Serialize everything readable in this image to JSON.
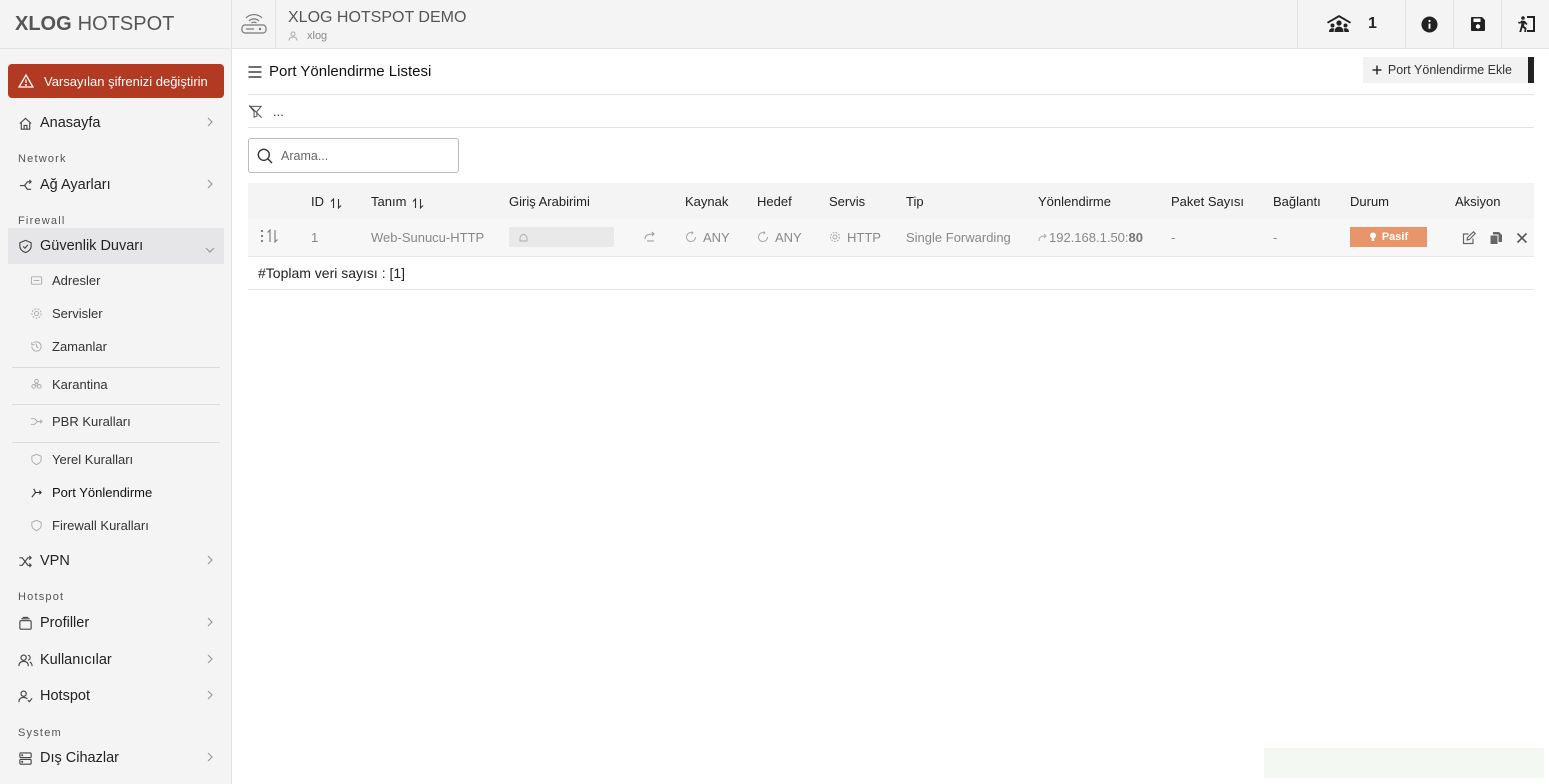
{
  "brand": {
    "bold": "XLOG",
    "light": "HOTSPOT"
  },
  "alert": {
    "text": "Varsayılan şifrenizi değiştirin"
  },
  "sidebar": {
    "home": "Anasayfa",
    "section_network": "Network",
    "network_settings": "Ağ Ayarları",
    "section_firewall": "Firewall",
    "firewall": "Güvenlik Duvarı",
    "sub": {
      "addresses": "Adresler",
      "services": "Servisler",
      "times": "Zamanlar",
      "quarantine": "Karantina",
      "pbr": "PBR Kuralları",
      "local_rules": "Yerel Kuralları",
      "port_forwarding": "Port Yönlendirme",
      "firewall_rules": "Firewall Kuralları"
    },
    "vpn": "VPN",
    "section_hotspot": "Hotspot",
    "profiles": "Profiller",
    "users": "Kullanıcılar",
    "hotspot": "Hotspot",
    "section_system": "System",
    "external_devices": "Dış Cihazlar"
  },
  "topbar": {
    "title": "XLOG HOTSPOT DEMO",
    "subtitle": "xlog",
    "online_count": "1"
  },
  "page": {
    "title": "Port Yönlendirme Listesi",
    "add_button": "Port Yönlendirme Ekle",
    "filter_text": "...",
    "search_placeholder": "Arama..."
  },
  "table": {
    "headers": {
      "id": "ID",
      "name": "Tanım",
      "iface": "Giriş Arabirimi",
      "source": "Kaynak",
      "dest": "Hedef",
      "service": "Servis",
      "type": "Tip",
      "forward": "Yönlendirme",
      "packets": "Paket Sayısı",
      "conn": "Bağlantı",
      "status": "Durum",
      "action": "Aksiyon"
    },
    "rows": [
      {
        "id": "1",
        "name": "Web-Sunucu-HTTP",
        "source": "ANY",
        "dest": "ANY",
        "service": "HTTP",
        "type": "Single Forwarding",
        "forward_ip": "192.168.1.50:",
        "forward_port": "80",
        "packets": "-",
        "conn": "-",
        "status": "Pasif"
      }
    ],
    "total": "#Toplam veri sayısı : [1]"
  },
  "colors": {
    "alert_bg": "#b33a22",
    "status_passive": "#e9956a"
  }
}
